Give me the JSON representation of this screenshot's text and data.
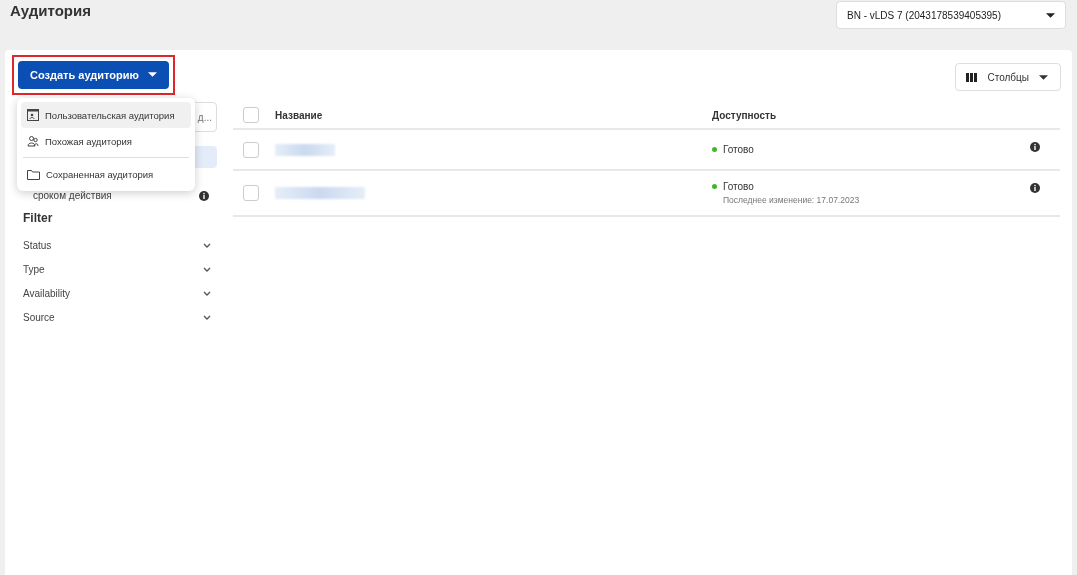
{
  "page_title": "Аудитория",
  "account_selector": {
    "value": "BN - vLDS 7 (2043178539405395)"
  },
  "create_button": {
    "label": "Создать аудиторию",
    "highlighted": true
  },
  "create_menu": [
    {
      "kind": "custom",
      "label": "Пользовательская аудитория",
      "selected": true
    },
    {
      "kind": "lookalike",
      "label": "Похожая аудитория",
      "selected": false
    },
    {
      "kind": "saved",
      "label": "Сохраненная аудитория",
      "selected": false
    }
  ],
  "sidebar": {
    "search_text": "д...",
    "item_text": "сроком действия"
  },
  "filter": {
    "title": "Filter",
    "items": [
      {
        "label": "Status",
        "expanded": false
      },
      {
        "label": "Type",
        "expanded": false
      },
      {
        "label": "Availability",
        "expanded": false
      },
      {
        "label": "Source",
        "expanded": false
      }
    ]
  },
  "columns_button": {
    "label": "Столбцы"
  },
  "table": {
    "columns": [
      "Название",
      "Доступность"
    ],
    "select_all_checked": false,
    "rows": [
      {
        "checked": false,
        "status": "Готово",
        "color": "#42b72a"
      },
      {
        "checked": false,
        "status": "Готово",
        "color": "#42b72a",
        "note": "Последнее изменение: 17.07.2023"
      }
    ]
  }
}
